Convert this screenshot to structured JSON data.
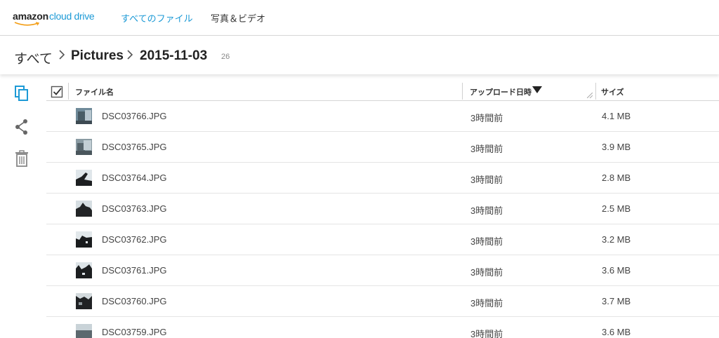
{
  "app": {
    "logo_amazon": "amazon",
    "logo_product": "cloud drive",
    "brand_color": "#1d9ad6"
  },
  "nav": {
    "all_files": "すべてのファイル",
    "photos_videos": "写真＆ビデオ"
  },
  "breadcrumb": {
    "root": "すべて",
    "folder": "Pictures",
    "current": "2015-11-03",
    "count": "26"
  },
  "actions": {
    "copy_icon": "copy-icon",
    "share_icon": "share-icon",
    "trash_icon": "trash-icon"
  },
  "table": {
    "columns": {
      "name": "ファイル名",
      "uploaded": "アップロード日時",
      "size": "サイズ"
    },
    "sort": "uploaded-desc",
    "rows": [
      {
        "name": "DSC03766.JPG",
        "uploaded": "3時間前",
        "size": "4.1 MB"
      },
      {
        "name": "DSC03765.JPG",
        "uploaded": "3時間前",
        "size": "3.9 MB"
      },
      {
        "name": "DSC03764.JPG",
        "uploaded": "3時間前",
        "size": "2.8 MB"
      },
      {
        "name": "DSC03763.JPG",
        "uploaded": "3時間前",
        "size": "2.5 MB"
      },
      {
        "name": "DSC03762.JPG",
        "uploaded": "3時間前",
        "size": "3.2 MB"
      },
      {
        "name": "DSC03761.JPG",
        "uploaded": "3時間前",
        "size": "3.6 MB"
      },
      {
        "name": "DSC03760.JPG",
        "uploaded": "3時間前",
        "size": "3.7 MB"
      },
      {
        "name": "DSC03759.JPG",
        "uploaded": "3時間前",
        "size": "3.6 MB"
      }
    ]
  }
}
